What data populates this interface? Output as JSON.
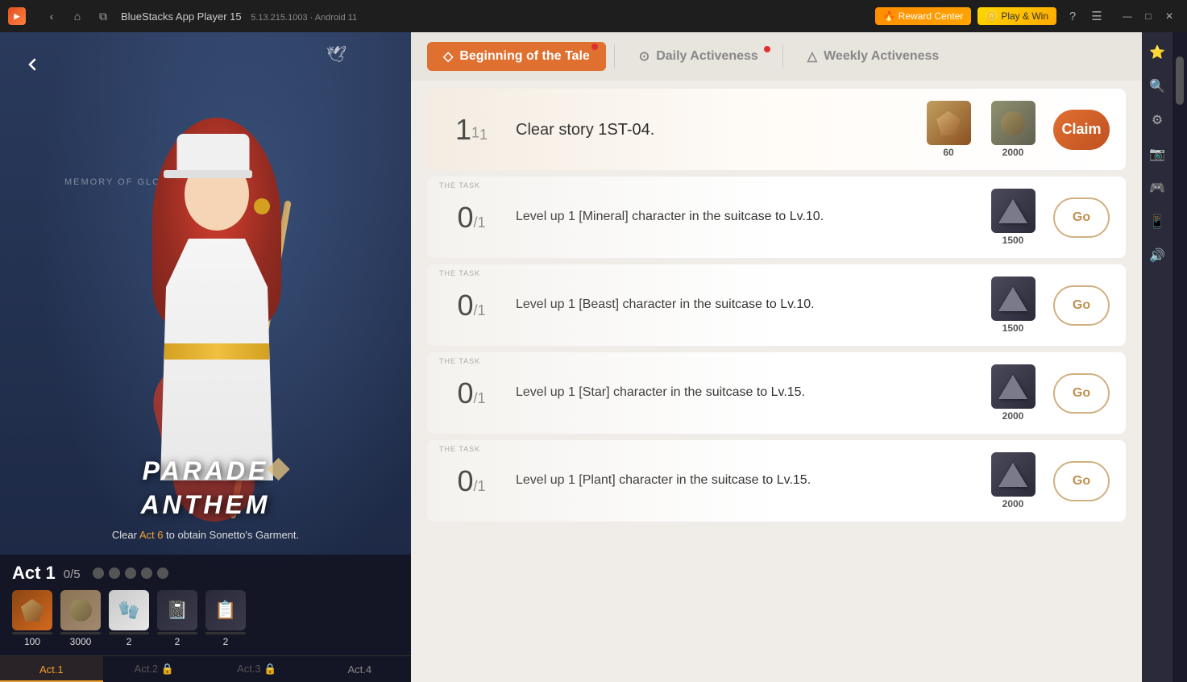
{
  "titlebar": {
    "logo_text": "BS",
    "app_name": "BlueStacks App Player 15",
    "version": "5.13.215.1003 · Android 11",
    "back_label": "‹",
    "home_label": "⌂",
    "tabs_label": "⧉",
    "reward_center_label": "Reward Center",
    "play_win_label": "Play & Win",
    "help_label": "?",
    "menu_label": "☰",
    "minimize_label": "—",
    "maximize_label": "□",
    "close_label": "✕"
  },
  "left_panel": {
    "back_btn": "◁",
    "memory_label": "MEMORY OF GLORY",
    "game_title": "PARADE ANTHEM",
    "story_text_pre": "Clear ",
    "story_act_link": "Act 6",
    "story_text_post": " to obtain Sonetto's Garment.",
    "bird_deco": "🕊"
  },
  "act_panel": {
    "title": "Act 1",
    "progress": "0/5",
    "dots": [
      {
        "done": false
      },
      {
        "done": false
      },
      {
        "done": false
      },
      {
        "done": false
      },
      {
        "done": false
      }
    ],
    "rewards": [
      {
        "type": "gem",
        "count": "100",
        "bar": 0
      },
      {
        "type": "coin",
        "count": "3000",
        "bar": 0
      },
      {
        "type": "gloves",
        "count": "2",
        "bar": 0
      },
      {
        "type": "book",
        "count": "2",
        "bar": 0
      },
      {
        "type": "note",
        "count": "2",
        "bar": 0
      }
    ],
    "tabs": [
      {
        "label": "Act.1",
        "locked": false,
        "active": true
      },
      {
        "label": "Act.2",
        "locked": true,
        "active": false
      },
      {
        "label": "Act.3",
        "locked": true,
        "active": false
      },
      {
        "label": "Act.4",
        "locked": false,
        "active": false
      }
    ],
    "lock_icon": "🔒"
  },
  "tabs": {
    "beginning": {
      "label": "Beginning of the Tale",
      "icon": "◇",
      "active": true
    },
    "daily": {
      "label": "Daily Activeness",
      "icon": "⊙",
      "active": false
    },
    "weekly": {
      "label": "Weekly Activeness",
      "icon": "△",
      "active": false
    }
  },
  "tasks": [
    {
      "id": 1,
      "label": "",
      "numerator": "1",
      "denominator": "1",
      "description": "Clear story 1ST-04.",
      "reward_count": "60",
      "reward_count2": "2000",
      "reward_type": "gem_coin",
      "action": "Claim",
      "action_type": "claim",
      "watermark": ""
    },
    {
      "id": 2,
      "label": "THE TASK",
      "numerator": "0",
      "denominator": "1",
      "description": "Level up 1 [Mineral] character in the suitcase to Lv.10.",
      "reward_count": "1500",
      "reward_type": "triangle",
      "action": "Go",
      "action_type": "go",
      "watermark": ""
    },
    {
      "id": 3,
      "label": "THE TASK",
      "numerator": "0",
      "denominator": "1",
      "description": "Level up 1 [Beast] character in the suitcase to Lv.10.",
      "reward_count": "1500",
      "reward_type": "triangle",
      "action": "Go",
      "action_type": "go",
      "watermark": ""
    },
    {
      "id": 4,
      "label": "THE TASK",
      "numerator": "0",
      "denominator": "1",
      "description": "Level up 1 [Star] character in the suitcase to Lv.15.",
      "reward_count": "2000",
      "reward_type": "triangle",
      "action": "Go",
      "action_type": "go",
      "watermark": ""
    },
    {
      "id": 5,
      "label": "THE TASK",
      "numerator": "0",
      "denominator": "1",
      "description": "Level up 1 [Plant] character in the suitcase to Lv.15.",
      "reward_count": "2000",
      "reward_type": "triangle",
      "action": "Go",
      "action_type": "go",
      "watermark": ""
    }
  ]
}
